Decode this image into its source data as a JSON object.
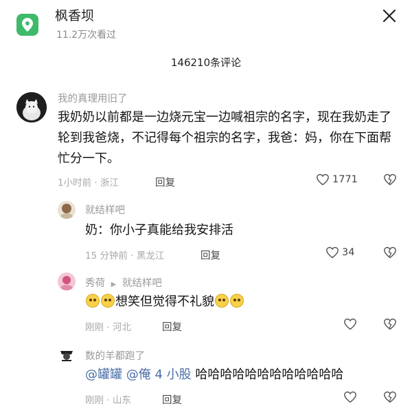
{
  "header": {
    "location_title": "枫香坝",
    "views": "11.2万次看过"
  },
  "comment_count": "146210条评论",
  "comments": [
    {
      "user": "我的真理用旧了",
      "text": "我奶奶以前都是一边烧元宝一边喊祖宗的名字，现在我奶走了轮到我爸烧，不记得每个祖宗的名字，我爸：妈，你在下面帮忙分一下。",
      "meta": "1小时前 · 浙江",
      "reply_label": "回复",
      "likes": "1771"
    },
    {
      "user": "就结样吧",
      "text": "奶：你小子真能给我安排活",
      "meta": "15 分钟前 · 黑龙江",
      "reply_label": "回复",
      "likes": "34"
    },
    {
      "user": "秀荷",
      "reply_to": "就结样吧",
      "text": "想笑但觉得不礼貌",
      "meta": "刚刚 · 河北",
      "reply_label": "回复"
    },
    {
      "user": "数的羊都跑了",
      "mentions": [
        "@罐罐",
        "@俺 4 小股"
      ],
      "text": "哈哈哈哈哈哈哈哈哈哈哈哈",
      "meta": "刚刚 · 山东",
      "reply_label": "回复"
    }
  ],
  "icons": [
    "location-icon",
    "close-icon",
    "heart-icon",
    "dislike-heart-icon",
    "arrow-right-icon",
    "emoji-icon"
  ],
  "colors": {
    "accent": "#3fba6a",
    "mention": "#4a6ea8",
    "muted": "#a8a8a8"
  }
}
